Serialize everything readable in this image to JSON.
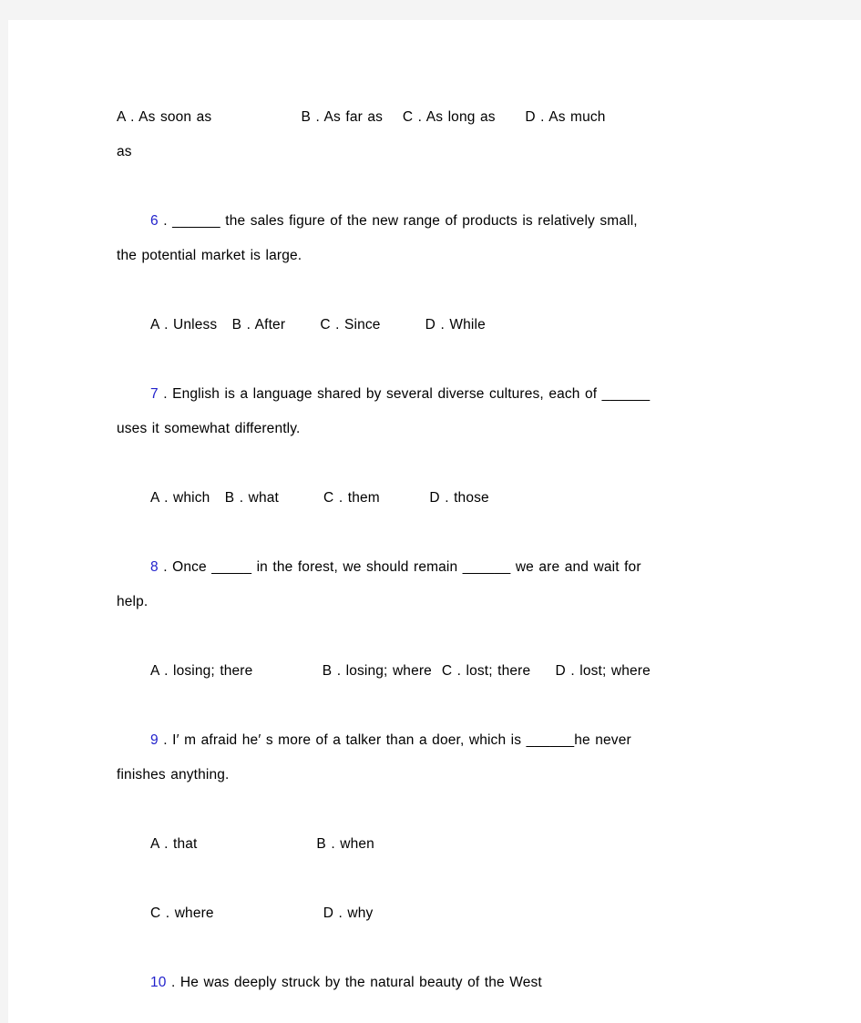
{
  "document": {
    "page_background": "#ffffff",
    "canvas_background": "#f4f4f4",
    "number_color": "#2222cc",
    "text_color": "#000000"
  },
  "content": {
    "q5_options_line1": "A . As soon as                  B . As far as    C . As long as      D . As much",
    "q5_options_line2": "as",
    "q6": {
      "number": "6",
      "dot": " . ",
      "stem_line1": "______ the sales figure of the new range of products is relatively small,",
      "stem_line2": "the potential market is large.",
      "options": "A . Unless   B . After       C . Since         D . While"
    },
    "q7": {
      "number": "7",
      "dot": " . ",
      "stem_line1": "English is a language shared by several diverse cultures, each of ______",
      "stem_line2": "uses it somewhat differently.",
      "options": "A . which   B . what         C . them          D . those"
    },
    "q8": {
      "number": "8",
      "dot": " . ",
      "stem_line1": "Once _____ in the forest, we should remain ______ we are and wait for",
      "stem_line2": "help.",
      "options": "A . losing; there              B . losing; where  C . lost; there     D . lost; where"
    },
    "q9": {
      "number": "9",
      "dot": " . ",
      "stem_line1": "I′ m afraid he′ s more of a talker than a doer, which is ______he never",
      "stem_line2": "finishes anything.",
      "options_line1": "A . that                        B . when",
      "options_line2": "C . where                      D . why"
    },
    "q10": {
      "number": "10",
      "dot": " . ",
      "stem_line1": "He was deeply struck by the natural beauty of the West"
    }
  }
}
